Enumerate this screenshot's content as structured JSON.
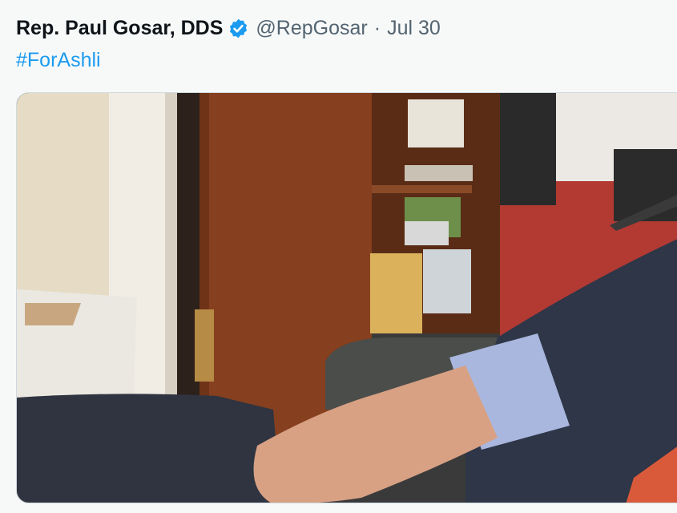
{
  "tweet": {
    "author_name": "Rep. Paul Gosar, DDS",
    "verified_icon": "verified-badge-icon",
    "handle": "@RepGosar",
    "separator": "·",
    "date": "Jul 30",
    "text": "#ForAshli",
    "media": {
      "type": "photo"
    }
  },
  "colors": {
    "background": "#f7f9f9",
    "name": "#0f1419",
    "secondary": "#536471",
    "link": "#1d9bf0",
    "verified": "#1d9bf0"
  }
}
